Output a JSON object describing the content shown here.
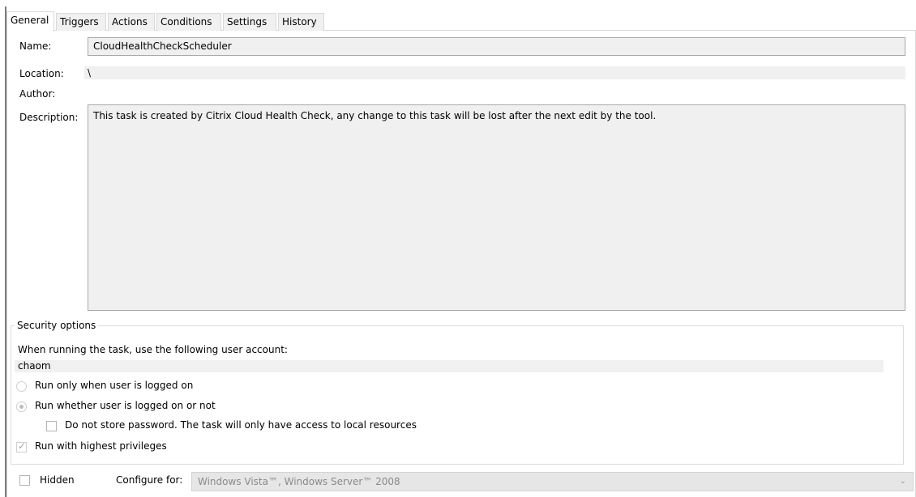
{
  "tabs": [
    {
      "label": "General",
      "active": true
    },
    {
      "label": "Triggers"
    },
    {
      "label": "Actions"
    },
    {
      "label": "Conditions"
    },
    {
      "label": "Settings"
    },
    {
      "label": "History"
    }
  ],
  "general": {
    "name_label": "Name:",
    "name_value": "CloudHealthCheckScheduler",
    "location_label": "Location:",
    "location_value": "\\",
    "author_label": "Author:",
    "author_value": "",
    "description_label": "Description:",
    "description_value": "This task is created by Citrix Cloud Health Check, any change to this task will be lost after the next edit by the tool."
  },
  "security": {
    "title": "Security options",
    "account_prompt": "When running the task, use the following user account:",
    "account": "chaom",
    "radio_logged_on": "Run only when user is logged on",
    "radio_whether": "Run whether user is logged on or not",
    "radio_selected": "whether",
    "no_store_password": "Do not store password.  The task will only have access to local resources",
    "no_store_password_checked": false,
    "highest_privileges": "Run with highest privileges",
    "highest_privileges_checked": true
  },
  "footer": {
    "hidden_label": "Hidden",
    "hidden_checked": false,
    "configure_label": "Configure for:",
    "configure_value": "Windows Vista™, Windows Server™ 2008"
  }
}
